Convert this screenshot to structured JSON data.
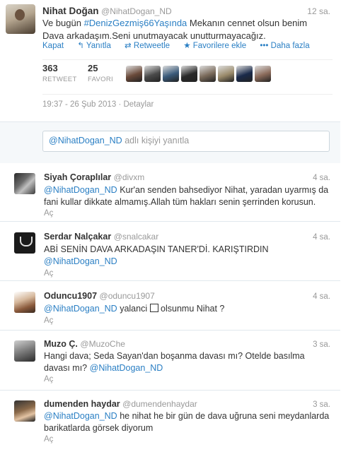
{
  "tweet": {
    "author_name": "Nihat Doğan",
    "author_handle": "@NihatDogan_ND",
    "time": "12 sa.",
    "text_pre": "Ve bugün ",
    "hashtag": "#DenizGezmiş66Yaşında",
    "text_post": " Mekanın cennet olsun benim Dava arkadaşım.Seni unutmayacak unutturmayacağız.",
    "actions": {
      "collapse": "Kapat",
      "reply": "Yanıtla",
      "retweet": "Retweetle",
      "favorite": "Favorilere ekle",
      "more": "Daha fazla"
    },
    "stats": {
      "retweets": "363",
      "retweets_label": "RETWEET",
      "favorites": "25",
      "favorites_label": "FAVORI"
    },
    "favoriter_colors": [
      "#6a4a3a",
      "#4a4a4a",
      "#3a5a7a",
      "#2a2a2a",
      "#7a6a5a",
      "#9a8a6a",
      "#1a2a4a",
      "#8a6a5a"
    ],
    "date": "19:37 - 26 Şub 2013",
    "details": "Detaylar"
  },
  "reply_box": {
    "mention": "@NihatDogan_ND",
    "placeholder": "adlı kişiyi yanıtla"
  },
  "replies": [
    {
      "name": "Siyah Çoraplılar",
      "handle": "@divxm",
      "time": "4 sa.",
      "mention": "@NihatDogan_ND",
      "text": " Kur'an senden bahsediyor Nihat, yaradan uyarmış da fani kullar dikkate almamış.Allah tüm hakları senin şerrinden korusun.",
      "action": "Aç"
    },
    {
      "name": "Serdar Nalçakar",
      "handle": "@snalcakar",
      "time": "4 sa.",
      "text": "ABİ SENİN DAVA ARKADAŞIN TANER'Dİ. KARIŞTIRDIN ",
      "mention": "@NihatDogan_ND",
      "action": "Aç"
    },
    {
      "name": "Oduncu1907",
      "handle": "@oduncu1907",
      "time": "4 sa.",
      "mention": "@NihatDogan_ND",
      "text_pre": " yalanci ",
      "text_post": " olsunmu Nihat ?",
      "action": "Aç"
    },
    {
      "name": "Muzo Ç.",
      "handle": "@MuzoChe",
      "time": "3 sa.",
      "text": "Hangi dava; Seda Sayan'dan boşanma davası mı? Otelde basılma davası mı? ",
      "mention": "@NihatDogan_ND",
      "action": "Aç"
    },
    {
      "name": "dumenden haydar",
      "handle": "@dumendenhaydar",
      "time": "3 sa.",
      "mention": "@NihatDogan_ND",
      "text": " he nihat he bir gün de dava uğruna seni meydanlarda barikatlarda görsek diyorum",
      "action": "Aç"
    }
  ]
}
